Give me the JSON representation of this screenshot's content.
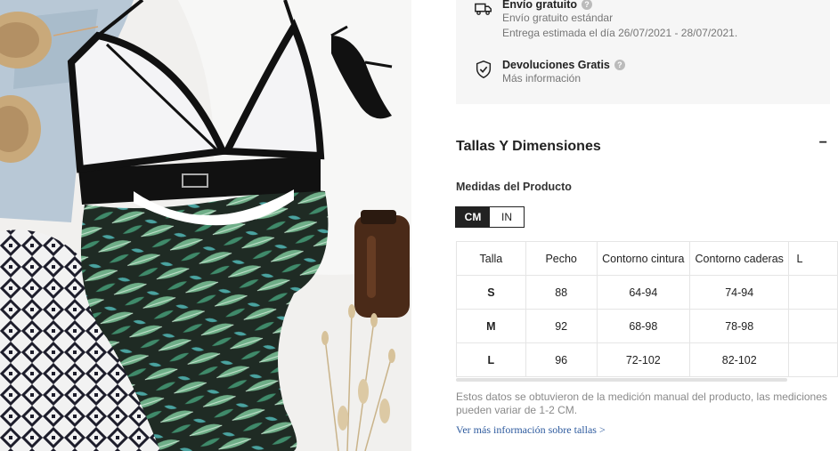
{
  "shipping": {
    "free_shipping_title": "Envío gratuito",
    "free_shipping_sub": "Envío gratuito estándar",
    "delivery_estimate": "Entrega estimada el día 26/07/2021 - 28/07/2021.",
    "returns_title": "Devoluciones Gratis",
    "returns_sub": "Más información",
    "help_glyph": "?"
  },
  "sizes_section": {
    "title": "Tallas Y Dimensiones",
    "collapse_glyph": "−",
    "measure_label": "Medidas del Producto",
    "units": [
      "CM",
      "IN"
    ],
    "active_unit": "CM",
    "table": {
      "headers": [
        "Talla",
        "Pecho",
        "Contorno cintura",
        "Contorno caderas",
        "L"
      ],
      "rows": [
        [
          "S",
          "88",
          "64-94",
          "74-94",
          ""
        ],
        [
          "M",
          "92",
          "68-98",
          "78-98",
          ""
        ],
        [
          "L",
          "96",
          "72-102",
          "82-102",
          ""
        ]
      ]
    },
    "note": "Estos datos se obtuvieron de la medición manual del producto, las mediciones pueden variar de 1-2 CM.",
    "more_link": "Ver más información sobre tallas >"
  },
  "icons": {
    "truck": "truck-icon",
    "shield": "shield-check-icon"
  },
  "colors": {
    "panel_bg": "#f6f6f6",
    "link": "#2d5a9e",
    "toggle_active": "#222222"
  }
}
